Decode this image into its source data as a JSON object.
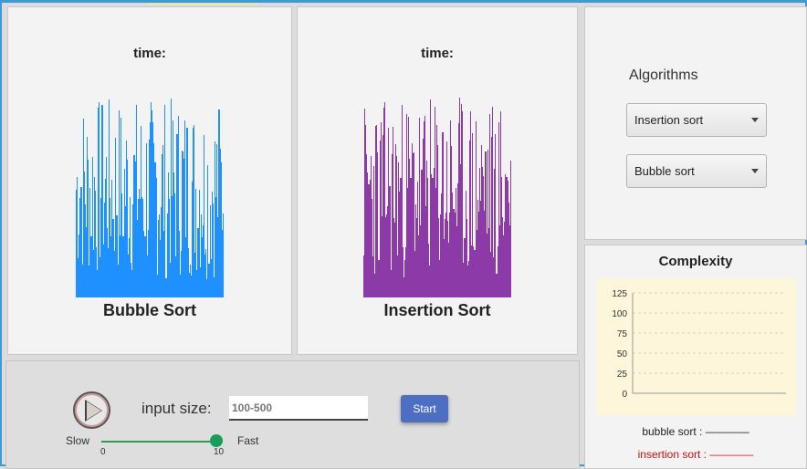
{
  "bubble_panel": {
    "time_label": "time:",
    "title": "Bubble Sort",
    "bar_color": "#1e90ff"
  },
  "insertion_panel": {
    "time_label": "time:",
    "title": "Insertion Sort",
    "bar_color": "#8b3aa8"
  },
  "algorithms": {
    "title": "Algorithms",
    "first_select": "Insertion sort",
    "second_select": "Bubble sort"
  },
  "complexity": {
    "title": "Complexity",
    "legend_bubble": "bubble sort : ————",
    "legend_insertion": "insertion sort : ————",
    "legend_insertion_color": "#cc1111",
    "chart_data": {
      "type": "line",
      "title": "",
      "xlabel": "",
      "ylabel": "",
      "ylim": [
        0,
        125
      ],
      "yticks": [
        "125",
        "100",
        "75",
        "50",
        "25",
        "0"
      ],
      "series": [],
      "grid": true
    }
  },
  "controls": {
    "play_icon": "play-icon",
    "input_label": "input size:",
    "input_placeholder": "100-500",
    "start_label": "Start",
    "slow_label": "Slow",
    "fast_label": "Fast",
    "slider_min": "0",
    "slider_max": "10",
    "slider_value": 10
  }
}
